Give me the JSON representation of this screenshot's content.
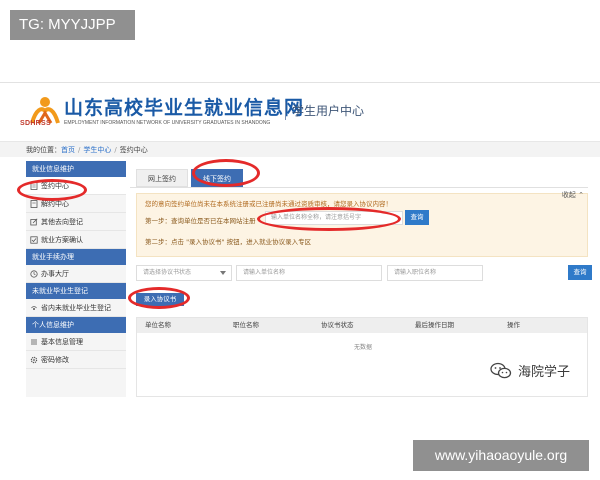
{
  "overlay": {
    "tg_label": "TG: MYYJJPP",
    "url_watermark": "www.yihaoaoyule.org",
    "wechat_watermark": "海院学子"
  },
  "header": {
    "site_title": "山东高校毕业生就业信息网",
    "logo_text": "SDHRSS",
    "subtitle": "EMPLOYMENT INFORMATION NETWORK OF UNIVERSITY GRADUATES IN SHANDONG",
    "center_title": "学生用户中心"
  },
  "breadcrumb": {
    "prefix": "我的位置：",
    "items": [
      "首页",
      "学生中心",
      "签约中心"
    ]
  },
  "sidebar": {
    "sections": [
      {
        "title": "就业信息维护",
        "items": [
          "签约中心",
          "解约中心",
          "其他去向登记",
          "就业方案确认"
        ]
      },
      {
        "title": "就业手续办理",
        "items": [
          "办事大厅"
        ]
      },
      {
        "title": "未就业毕业生登记",
        "items": [
          "省内未就业毕业生登记"
        ]
      },
      {
        "title": "个人信息维护",
        "items": [
          "基本信息管理",
          "密码修改"
        ]
      }
    ]
  },
  "tabs": [
    "网上签约",
    "线下签约"
  ],
  "collapse_label": "收起",
  "notice": {
    "line1": "您的意向签约单位尚未在本系统注册或已注册尚未通过资质审核，请您录入协议内容！",
    "step1": "第一步：查询单位是否已在本网站注册",
    "step1_placeholder": "输入单位名称全称，请注意括号字",
    "step1_button": "查询",
    "step2": "第二步：点击 \"录入协议书\" 按钮，进入就业协议录入专区"
  },
  "filters": {
    "status_placeholder": "请选择协议书状态",
    "unit_placeholder": "请输入单位名称",
    "position_placeholder": "请输入职位名称",
    "query_button": "查询"
  },
  "add_button": "录入协议书",
  "table": {
    "headers": [
      "单位名称",
      "职位名称",
      "协议书状态",
      "最后操作日期",
      "操作"
    ],
    "empty_text": "无数据"
  },
  "colors": {
    "brand_blue": "#3d6db3",
    "button_blue": "#2f7ac9",
    "annotation_red": "#e42a2a",
    "notice_bg": "#fdf4e4"
  }
}
